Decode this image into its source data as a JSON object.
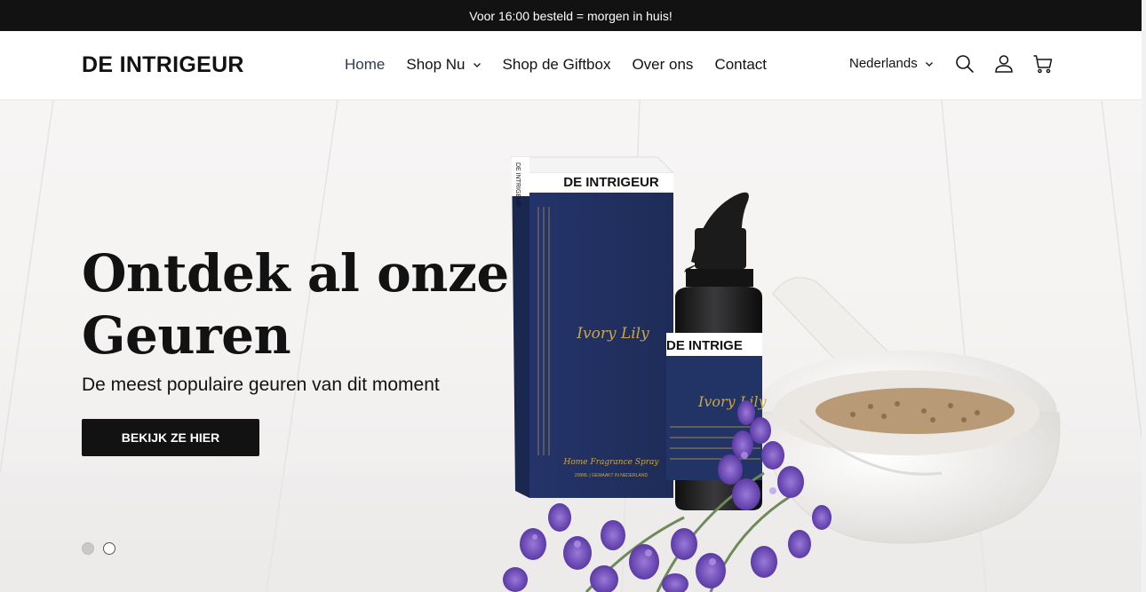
{
  "announcement": {
    "text": "Voor 16:00 besteld = morgen in huis!"
  },
  "header": {
    "logo": "DE INTRIGEUR",
    "nav": [
      {
        "label": "Home",
        "active": true,
        "dropdown": false
      },
      {
        "label": "Shop Nu",
        "active": false,
        "dropdown": true
      },
      {
        "label": "Shop de Giftbox",
        "active": false,
        "dropdown": false
      },
      {
        "label": "Over ons",
        "active": false,
        "dropdown": false
      },
      {
        "label": "Contact",
        "active": false,
        "dropdown": false
      }
    ],
    "language": "Nederlands",
    "icons": [
      "search-icon",
      "account-icon",
      "cart-icon"
    ]
  },
  "hero": {
    "title_line1": "Ontdek al onze",
    "title_line2": "Geuren",
    "subtitle": "De meest populaire geuren van dit moment",
    "button_label": "BEKIJK ZE HIER",
    "slides": {
      "count": 2,
      "active": 1
    },
    "product": {
      "brand": "DE INTRIGEUR",
      "brand_bottle": "DE INTRIGE",
      "box_side_brand": "DE INTRIGEUR",
      "script_name": "Ivory Lily",
      "box_caption": "Home Fragrance Spray",
      "box_small": "200ML | GEMAAKT IN NEDERLAND"
    }
  },
  "colors": {
    "announcement_bg": "#121212",
    "button_bg": "#121212",
    "box_blue": "#22325e",
    "gold": "#c9a64a",
    "lavender": "#7b55c4"
  }
}
